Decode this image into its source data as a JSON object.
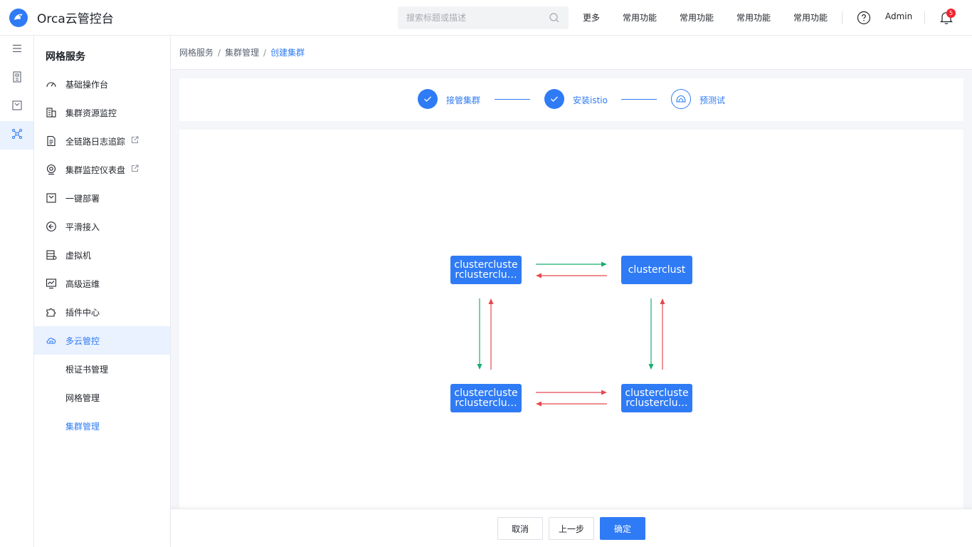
{
  "header": {
    "app_title": "Orca云管控台",
    "search_placeholder": "搜索标题或描述",
    "nav": [
      "更多",
      "常用功能",
      "常用功能",
      "常用功能",
      "常用功能"
    ],
    "user": "Admin",
    "notification_count": "5"
  },
  "sidebar": {
    "title": "网格服务",
    "items": [
      {
        "label": "基础操作台"
      },
      {
        "label": "集群资源监控"
      },
      {
        "label": "全链路日志追踪"
      },
      {
        "label": "集群监控仪表盘"
      },
      {
        "label": "一键部署"
      },
      {
        "label": "平滑接入"
      },
      {
        "label": "虚拟机"
      },
      {
        "label": "高级运维"
      },
      {
        "label": "插件中心"
      },
      {
        "label": "多云管控"
      }
    ],
    "sub_items": [
      {
        "label": "根证书管理"
      },
      {
        "label": "网格管理"
      },
      {
        "label": "集群管理"
      }
    ]
  },
  "breadcrumb": {
    "items": [
      "网格服务",
      "集群管理",
      "创建集群"
    ],
    "separator": "/"
  },
  "steps": [
    {
      "label": "接管集群",
      "status": "done"
    },
    {
      "label": "安装istio",
      "status": "done"
    },
    {
      "label": "预测试",
      "status": "current"
    }
  ],
  "diagram": {
    "nodes": [
      {
        "label": "clusterclusterclusterclustercluster"
      },
      {
        "label": "clusterclust"
      },
      {
        "label": "clusterclusterclusterclustercluster"
      },
      {
        "label": "clusterclusterclusterclustercluster"
      }
    ],
    "colors": {
      "forward": "#1aae6f",
      "backward": "#e5484d",
      "node": "#2f7bf5"
    }
  },
  "footer": {
    "cancel_label": "取消",
    "prev_label": "上一步",
    "confirm_label": "确定"
  },
  "colors": {
    "accent": "#2f7bf5"
  }
}
